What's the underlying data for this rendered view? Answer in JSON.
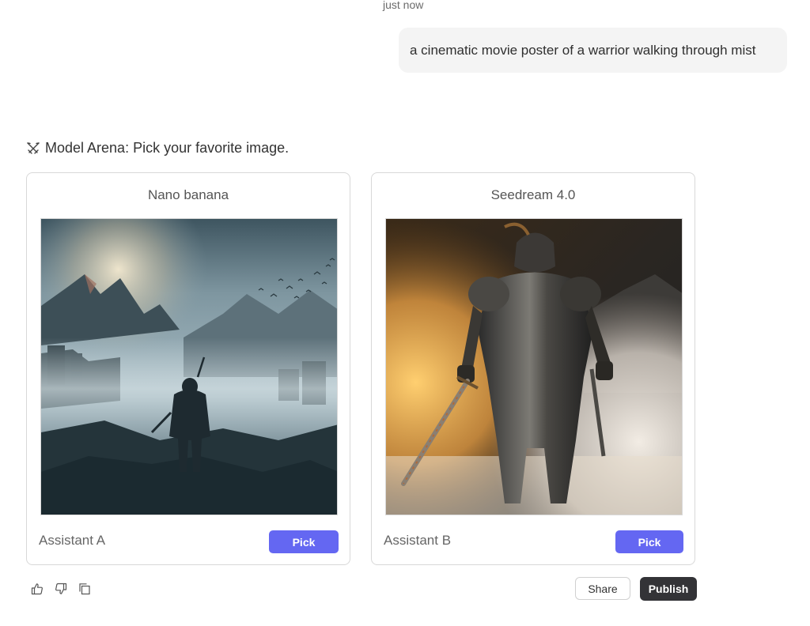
{
  "message": {
    "timestamp": "just now",
    "user_prompt": "a cinematic movie poster of a warrior walking through mist"
  },
  "arena": {
    "heading_icon": "swords-icon",
    "heading": "Model Arena: Pick your favorite image.",
    "cards": [
      {
        "model_name": "Nano banana",
        "image": "generated-image-warrior-misty-mountains",
        "assistant_label": "Assistant A",
        "pick_label": "Pick"
      },
      {
        "model_name": "Seedream 4.0",
        "image": "generated-image-armored-knight-smoke",
        "assistant_label": "Assistant B",
        "pick_label": "Pick"
      }
    ],
    "accent_color": "#6467f2"
  },
  "actions": {
    "feedback_icons": [
      "thumbs-up-icon",
      "thumbs-down-icon",
      "copy-icon"
    ],
    "share_label": "Share",
    "publish_label": "Publish"
  }
}
